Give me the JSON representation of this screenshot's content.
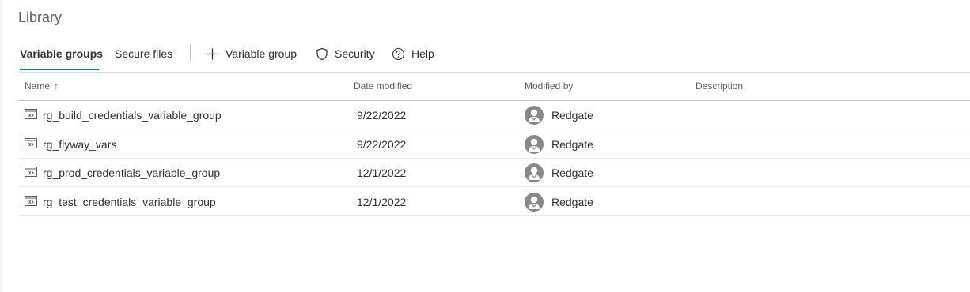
{
  "page": {
    "title": "Library"
  },
  "toolbar": {
    "tabs": [
      {
        "label": "Variable groups",
        "active": true
      },
      {
        "label": "Secure files",
        "active": false
      }
    ],
    "commands": [
      {
        "label": "Variable group",
        "icon": "plus-icon"
      },
      {
        "label": "Security",
        "icon": "shield-icon"
      },
      {
        "label": "Help",
        "icon": "help-circle-icon"
      }
    ]
  },
  "table": {
    "columns": {
      "name": "Name",
      "sort_indicator": "↑",
      "date": "Date modified",
      "modified_by": "Modified by",
      "description": "Description"
    },
    "rows": [
      {
        "name": "rg_build_credentials_variable_group",
        "date": "9/22/2022",
        "modified_by": "Redgate",
        "description": ""
      },
      {
        "name": "rg_flyway_vars",
        "date": "9/22/2022",
        "modified_by": "Redgate",
        "description": ""
      },
      {
        "name": "rg_prod_credentials_variable_group",
        "date": "12/1/2022",
        "modified_by": "Redgate",
        "description": ""
      },
      {
        "name": "rg_test_credentials_variable_group",
        "date": "12/1/2022",
        "modified_by": "Redgate",
        "description": ""
      }
    ]
  },
  "colors": {
    "accent": "#0078d4",
    "avatar": "#8a8886"
  }
}
